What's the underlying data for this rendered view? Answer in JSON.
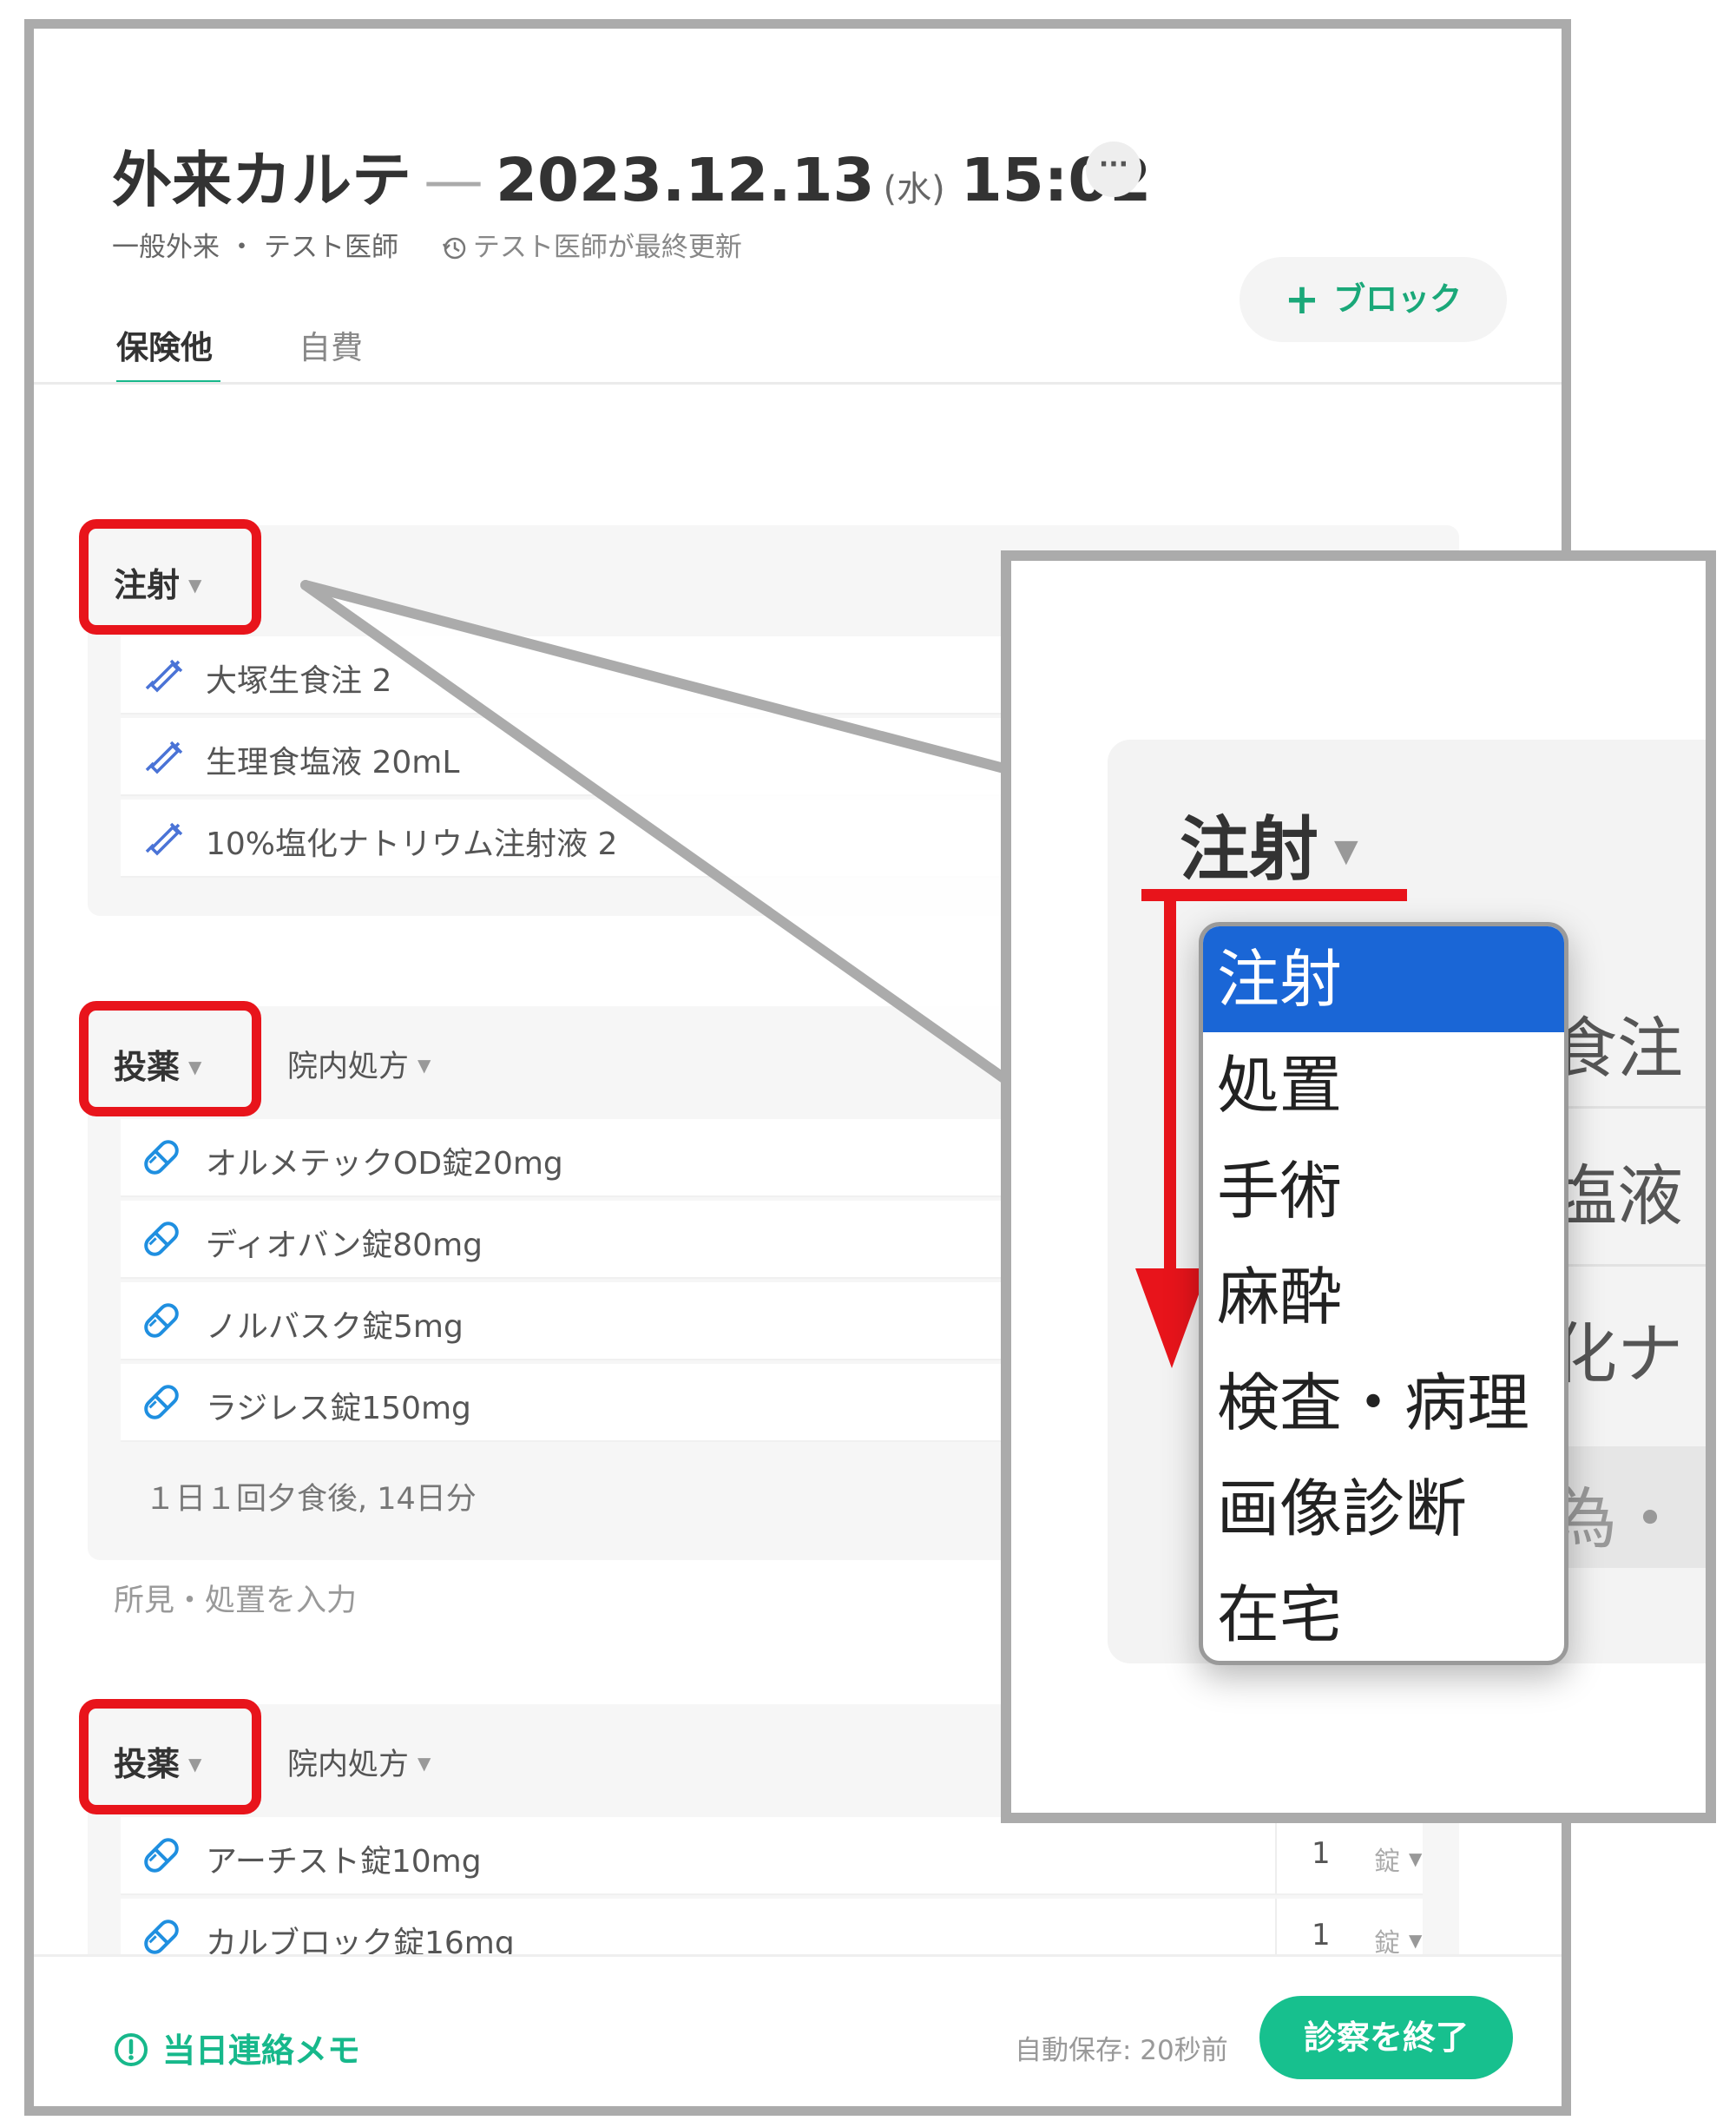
{
  "header": {
    "title": "外来カルテ",
    "dash": "—",
    "date": "2023.12.13",
    "weekday": "(水)",
    "time": "15:02",
    "more_label": "···",
    "department": "一般外来",
    "separator": "・",
    "doctor": "テスト医師",
    "last_updated": "テスト医師が最終更新"
  },
  "tabs": [
    {
      "label": "保険他"
    },
    {
      "label": "自費"
    }
  ],
  "add_block_label": "ブロック",
  "blocks": [
    {
      "label": "注射",
      "items": [
        {
          "name": "大塚生食注 2"
        },
        {
          "name": "生理食塩液 20mL"
        },
        {
          "name": "10%塩化ナトリウム注射液 2"
        }
      ]
    },
    {
      "label": "投薬",
      "sub_label": "院内処方",
      "items": [
        {
          "name": "オルメテックOD錠20mg"
        },
        {
          "name": "ディオバン錠80mg"
        },
        {
          "name": "ノルバスク錠5mg"
        },
        {
          "name": "ラジレス錠150mg"
        }
      ],
      "schedule": "１日１回夕食後, 14日分"
    },
    {
      "label": "投薬",
      "sub_label": "院内処方",
      "items": [
        {
          "name": "アーチスト錠10mg",
          "qty": "1",
          "unit": "錠"
        },
        {
          "name": "カルブロック錠16mg",
          "qty": "1",
          "unit": "錠"
        }
      ]
    }
  ],
  "findings_placeholder": "所見・処置を入力",
  "footer": {
    "memo_label": "当日連絡メモ",
    "autosave": "自動保存: 20秒前",
    "end_button": "診察を終了"
  },
  "zoom": {
    "label": "注射",
    "row_texts": [
      "食注",
      "塩液",
      "化ナ",
      "為・"
    ],
    "dropdown_options": [
      "注射",
      "処置",
      "手術",
      "麻酔",
      "検査・病理",
      "画像診断",
      "在宅"
    ],
    "selected_option": "注射"
  },
  "colors": {
    "accent_green": "#17b88b",
    "highlight_red": "#e8141b",
    "dropdown_selected": "#1a66d6",
    "frame_gray": "#ababab"
  }
}
